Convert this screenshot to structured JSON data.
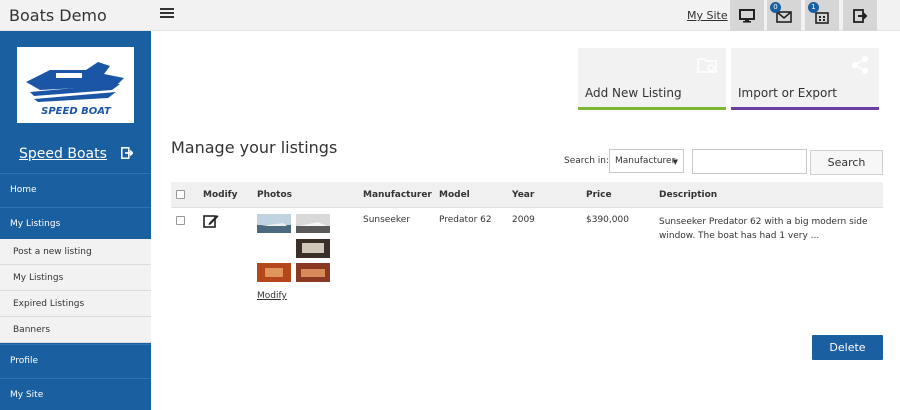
{
  "app": {
    "title": "Boats Demo"
  },
  "topbar": {
    "mysite_label": "My Site",
    "icons": [
      {
        "name": "monitor-icon"
      },
      {
        "name": "mail-icon",
        "badge": "0"
      },
      {
        "name": "building-icon",
        "badge": "1"
      },
      {
        "name": "sign-out-icon"
      }
    ]
  },
  "sidebar": {
    "logo_text": "SPEED BOAT",
    "brand_label": "Speed Boats",
    "items": [
      {
        "label": "Home"
      },
      {
        "label": "My Listings"
      },
      {
        "label": "Profile"
      },
      {
        "label": "My Site"
      }
    ],
    "subitems": [
      {
        "label": "Post a new listing"
      },
      {
        "label": "My Listings"
      },
      {
        "label": "Expired Listings"
      },
      {
        "label": "Banners"
      }
    ]
  },
  "cards": [
    {
      "label": "Add New Listing",
      "icon": "folder-settings-icon",
      "accent": "#7cb82f"
    },
    {
      "label": "Import or Export",
      "icon": "share-icon",
      "accent": "#6b3fa0"
    }
  ],
  "main": {
    "title": "Manage your listings",
    "search": {
      "label": "Search in:",
      "selected": "Manufacturer",
      "value": "",
      "button": "Search"
    },
    "table": {
      "headers": [
        "Modify",
        "Photos",
        "Manufacturer",
        "Model",
        "Year",
        "Price",
        "Description"
      ],
      "rows": [
        {
          "manufacturer": "Sunseeker",
          "model": "Predator 62",
          "year": "2009",
          "price": "$390,000",
          "description": "Sunseeker Predator 62 with a big modern side window. The boat has had 1 very ...",
          "modify_link": "Modify"
        }
      ]
    },
    "delete_label": "Delete"
  },
  "colors": {
    "primary": "#1a5fa0",
    "topbar": "#f2f2f2",
    "card": "#f2f2f2"
  }
}
